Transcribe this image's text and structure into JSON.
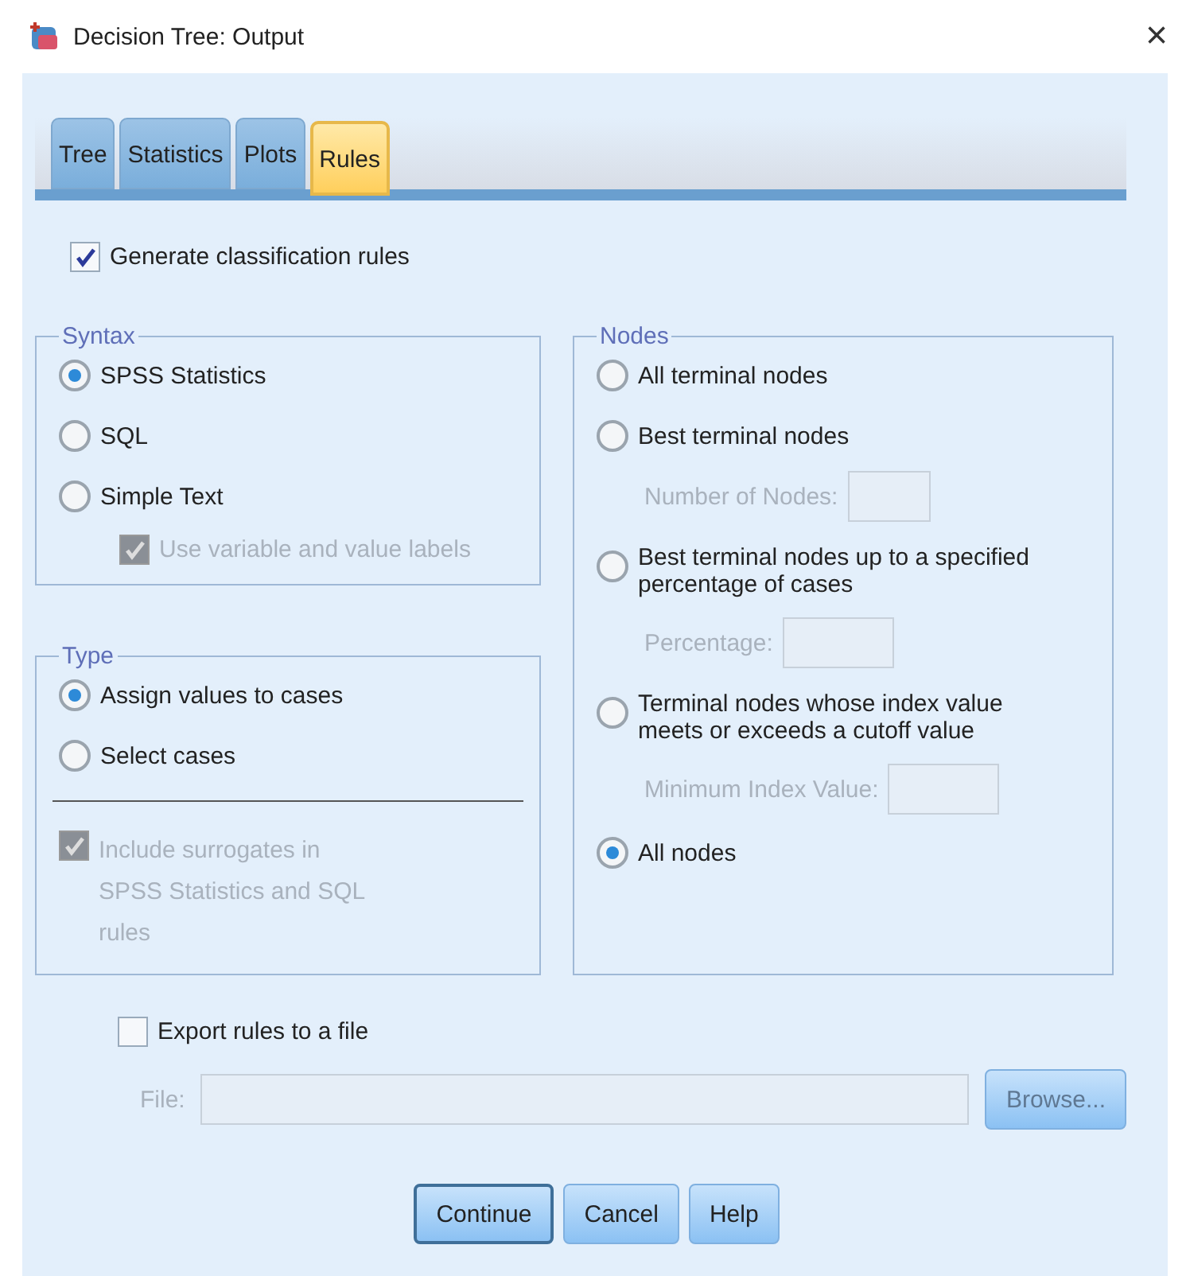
{
  "window": {
    "title": "Decision Tree: Output",
    "close": "×"
  },
  "tabs": [
    {
      "label": "Tree",
      "selected": false
    },
    {
      "label": "Statistics",
      "selected": false
    },
    {
      "label": "Plots",
      "selected": false
    },
    {
      "label": "Rules",
      "selected": true
    }
  ],
  "generate_rules": {
    "label": "Generate classification rules",
    "checked": true
  },
  "syntax": {
    "title": "Syntax",
    "options": [
      {
        "label": "SPSS Statistics",
        "selected": true
      },
      {
        "label": "SQL",
        "selected": false
      },
      {
        "label": "Simple Text",
        "selected": false
      }
    ],
    "use_labels": {
      "label": "Use variable and value labels",
      "checked": true,
      "disabled": true
    }
  },
  "type": {
    "title": "Type",
    "options": [
      {
        "label": "Assign values to cases",
        "selected": true
      },
      {
        "label": "Select cases",
        "selected": false
      }
    ],
    "include_surrogates": {
      "label": "Include surrogates in SPSS Statistics and SQL rules",
      "checked": true,
      "disabled": true
    }
  },
  "nodes": {
    "title": "Nodes",
    "options": [
      {
        "label": "All terminal nodes",
        "selected": false
      },
      {
        "label": "Best terminal nodes",
        "selected": false,
        "field": {
          "label": "Number of Nodes:",
          "disabled": true
        }
      },
      {
        "label": "Best terminal nodes up to a specified percentage of cases",
        "selected": false,
        "field": {
          "label": "Percentage:",
          "disabled": true
        }
      },
      {
        "label": "Terminal nodes whose index value meets or exceeds a cutoff value",
        "selected": false,
        "field": {
          "label": "Minimum Index Value:",
          "disabled": true
        }
      },
      {
        "label": "All nodes",
        "selected": true
      }
    ]
  },
  "export": {
    "label": "Export rules to a file",
    "checked": false
  },
  "file": {
    "label": "File:",
    "disabled": true
  },
  "browse": {
    "label": "Browse...",
    "disabled": true
  },
  "buttons": [
    {
      "label": "Continue",
      "default": true
    },
    {
      "label": "Cancel",
      "default": false
    },
    {
      "label": "Help",
      "default": false
    }
  ]
}
